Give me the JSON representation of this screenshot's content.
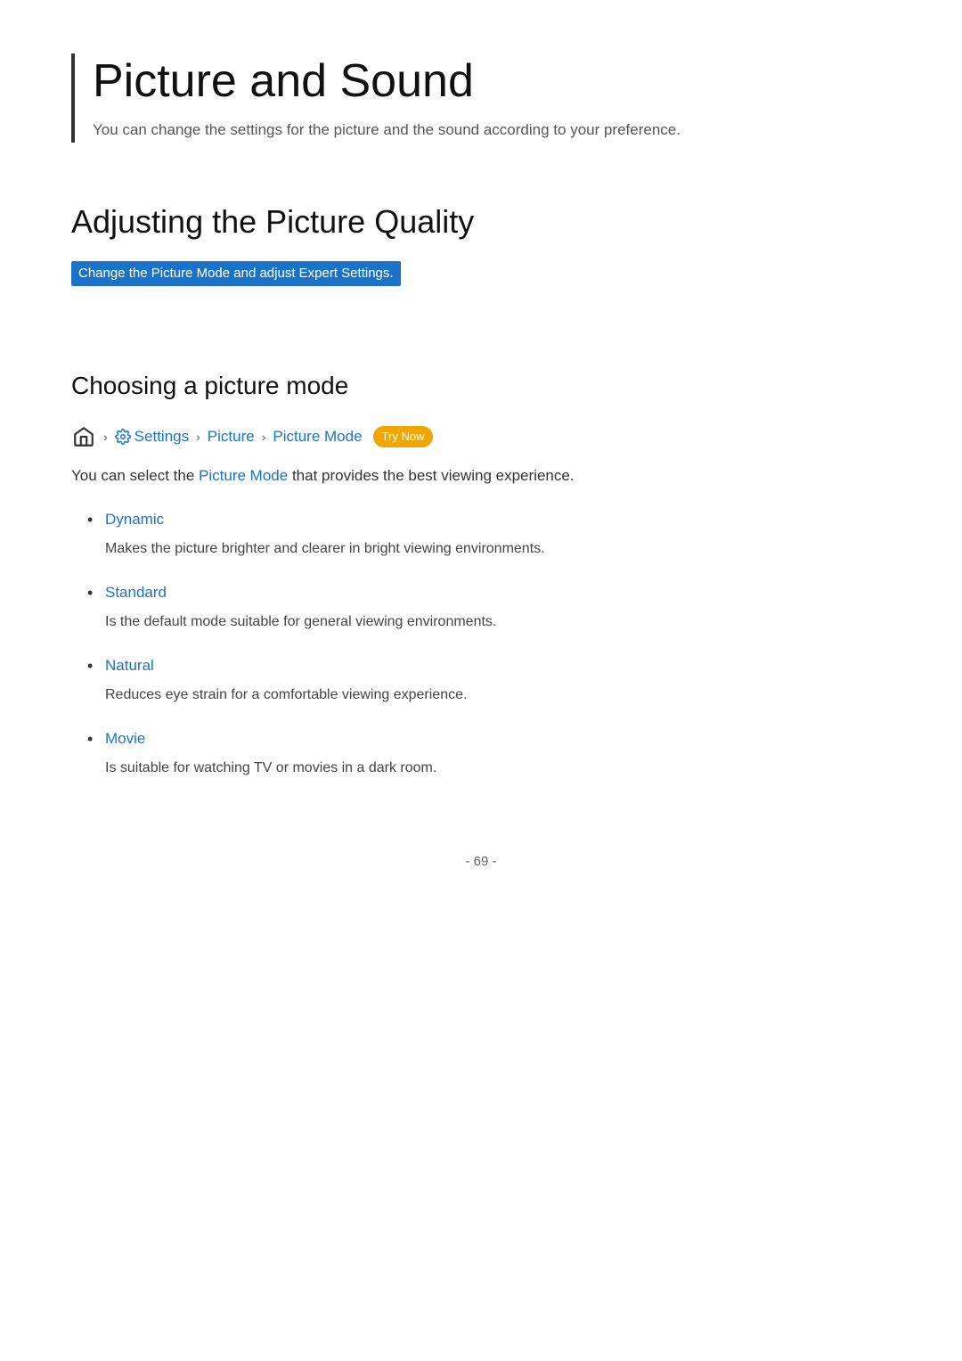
{
  "page": {
    "title": "Picture and Sound",
    "subtitle": "You can change the settings for the picture and the sound according to your preference.",
    "footer": "- 69 -"
  },
  "section1": {
    "title": "Adjusting the Picture Quality",
    "highlight": "Change the Picture Mode and adjust Expert Settings."
  },
  "section2": {
    "title": "Choosing a picture mode",
    "breadcrumb": {
      "settings": "Settings",
      "picture": "Picture",
      "picture_mode": "Picture Mode"
    },
    "try_now": "Try Now",
    "intro": "You can select the",
    "intro_link": "Picture Mode",
    "intro_rest": "that provides the best viewing experience.",
    "items": [
      {
        "term": "Dynamic",
        "desc": "Makes the picture brighter and clearer in bright viewing environments."
      },
      {
        "term": "Standard",
        "desc": "Is the default mode suitable for general viewing environments."
      },
      {
        "term": "Natural",
        "desc": "Reduces eye strain for a comfortable viewing experience."
      },
      {
        "term": "Movie",
        "desc": "Is suitable for watching TV or movies in a dark room."
      }
    ]
  }
}
